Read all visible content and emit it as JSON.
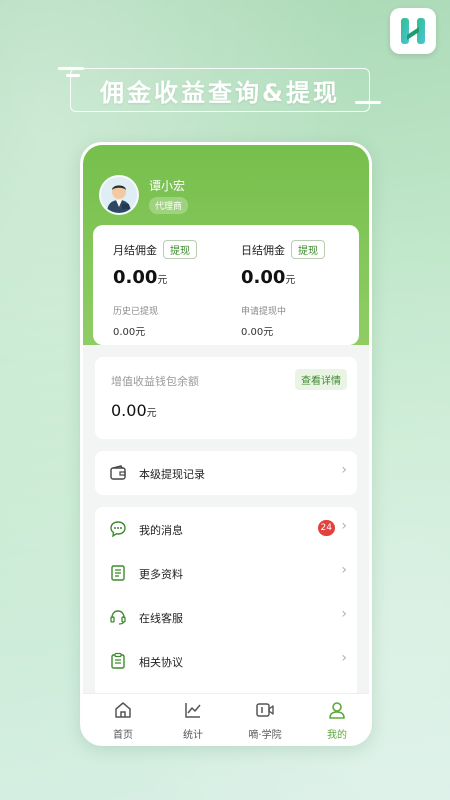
{
  "headline": "佣金收益查询&提现",
  "user": {
    "name": "谭小宏",
    "role": "代理商"
  },
  "commission": {
    "monthly": {
      "title": "月结佣金",
      "action": "提现",
      "amount": "0.00",
      "unit": "元",
      "history_label": "历史已提现",
      "history_value": "0.00元"
    },
    "daily": {
      "title": "日结佣金",
      "action": "提现",
      "amount": "0.00",
      "unit": "元",
      "history_label": "申请提现中",
      "history_value": "0.00元"
    }
  },
  "wallet": {
    "title": "增值收益钱包余额",
    "detail_label": "查看详情",
    "amount": "0.00",
    "unit": "元"
  },
  "record": {
    "label": "本级提现记录",
    "icon": "wallet-icon"
  },
  "menu": [
    {
      "label": "我的消息",
      "icon": "message-icon",
      "badge": "24"
    },
    {
      "label": "更多资料",
      "icon": "document-icon"
    },
    {
      "label": "在线客服",
      "icon": "headset-icon"
    },
    {
      "label": "相关协议",
      "icon": "clipboard-icon"
    }
  ],
  "tabs": [
    {
      "label": "首页",
      "icon": "home-icon"
    },
    {
      "label": "统计",
      "icon": "chart-icon"
    },
    {
      "label": "嘀·学院",
      "icon": "video-icon"
    },
    {
      "label": "我的",
      "icon": "person-icon"
    }
  ],
  "colors": {
    "brand_green": "#7cc253",
    "accent_text": "#3e8a2e",
    "badge_red": "#e2413d"
  }
}
